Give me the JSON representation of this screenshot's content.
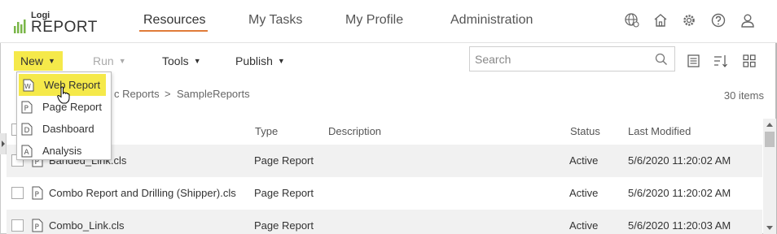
{
  "app": {
    "logo_small": "Logi",
    "logo_big": "REPORT"
  },
  "nav": {
    "tabs": [
      {
        "label": "Resources",
        "active": true
      },
      {
        "label": "My Tasks",
        "active": false
      },
      {
        "label": "My Profile",
        "active": false
      },
      {
        "label": "Administration",
        "active": false
      }
    ],
    "icons": [
      "globe-icon",
      "home-icon",
      "gear-icon",
      "help-icon",
      "user-icon"
    ]
  },
  "toolbar": {
    "new_label": "New",
    "run_label": "Run",
    "tools_label": "Tools",
    "publish_label": "Publish",
    "search_placeholder": "Search",
    "search_value": ""
  },
  "new_menu": {
    "items": [
      {
        "label": "Web Report",
        "icon": "web-report-icon",
        "highlighted": true
      },
      {
        "label": "Page Report",
        "icon": "page-report-icon",
        "highlighted": false
      },
      {
        "label": "Dashboard",
        "icon": "dashboard-icon",
        "highlighted": false
      },
      {
        "label": "Analysis",
        "icon": "analysis-icon",
        "highlighted": false
      }
    ]
  },
  "breadcrumb": {
    "items": [
      "c Reports",
      "SampleReports"
    ],
    "separator": ">"
  },
  "item_count": "30 items",
  "table": {
    "columns": [
      "Type",
      "Description",
      "Status",
      "Last Modified"
    ],
    "rows": [
      {
        "name": "Banded_Link.cls",
        "type": "Page Report",
        "description": "",
        "status": "Active",
        "modified": "5/6/2020 11:20:02 AM"
      },
      {
        "name": "Combo Report and Drilling (Shipper).cls",
        "type": "Page Report",
        "description": "",
        "status": "Active",
        "modified": "5/6/2020 11:20:02 AM"
      },
      {
        "name": "Combo_Link.cls",
        "type": "Page Report",
        "description": "",
        "status": "Active",
        "modified": "5/6/2020 11:20:03 AM"
      }
    ]
  },
  "colors": {
    "accent_yellow": "#f5e94a",
    "tab_underline": "#e07b39",
    "logo_green": "#7ab648"
  }
}
